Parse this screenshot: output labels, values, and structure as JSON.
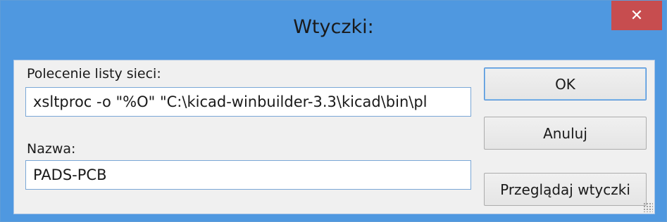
{
  "window": {
    "title": "Wtyczki:",
    "close_symbol": "✕",
    "close_color": "#c74d4f",
    "titlebar_color": "#4f98e0"
  },
  "form": {
    "command_label": "Polecenie listy sieci:",
    "command_value": "xsltproc -o \"%O\" \"C:\\kicad-winbuilder-3.3\\kicad\\bin\\pl",
    "name_label": "Nazwa:",
    "name_value": "PADS-PCB"
  },
  "buttons": {
    "ok": "OK",
    "cancel": "Anuluj",
    "browse": "Przeglądaj wtyczki"
  }
}
